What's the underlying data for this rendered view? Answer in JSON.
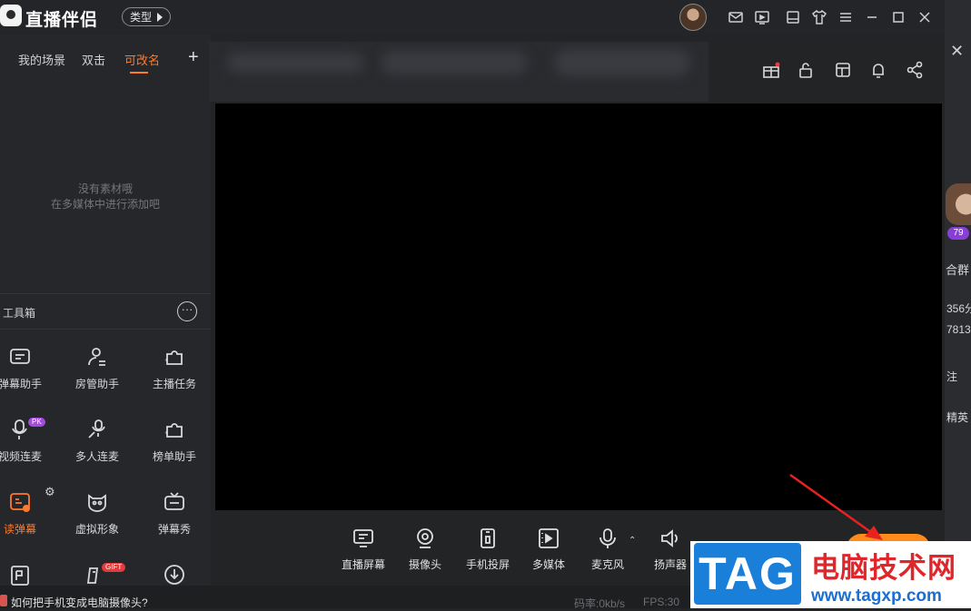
{
  "app": {
    "name": "直播伴侣",
    "type_button": "类型"
  },
  "scenes": {
    "tabs": [
      {
        "label": "我的场景",
        "active": false
      },
      {
        "label": "双击",
        "active": false
      },
      {
        "label": "可改名",
        "active": true
      }
    ],
    "add_icon": "plus-icon",
    "empty_line1": "没有素材哦",
    "empty_line2": "在多媒体中进行添加吧"
  },
  "toolbox": {
    "title": "工具箱",
    "tools": [
      {
        "label": "弹幕助手",
        "icon": "danmaku-helper-icon"
      },
      {
        "label": "房管助手",
        "icon": "room-admin-icon"
      },
      {
        "label": "主播任务",
        "icon": "puzzle-icon"
      },
      {
        "label": "视频连麦",
        "icon": "video-link-mic-icon",
        "badge": "PK"
      },
      {
        "label": "多人连麦",
        "icon": "multi-link-mic-icon"
      },
      {
        "label": "榜单助手",
        "icon": "puzzle-icon"
      },
      {
        "label": "读弹幕",
        "icon": "read-danmaku-icon",
        "active": true
      },
      {
        "label": "虚拟形象",
        "icon": "virtual-avatar-icon"
      },
      {
        "label": "弹幕秀",
        "icon": "tv-icon"
      },
      {
        "label": "",
        "icon": "text-icon"
      },
      {
        "label": "",
        "icon": "pk-icon",
        "badge": "GIFT"
      },
      {
        "label": "",
        "icon": "download-icon"
      }
    ]
  },
  "controls": [
    {
      "label": "直播屏幕",
      "icon": "screen-icon"
    },
    {
      "label": "摄像头",
      "icon": "camera-icon"
    },
    {
      "label": "手机投屏",
      "icon": "phone-cast-icon"
    },
    {
      "label": "多媒体",
      "icon": "media-icon"
    },
    {
      "label": "麦克风",
      "icon": "mic-icon"
    },
    {
      "label": "扬声器",
      "icon": "speaker-icon"
    }
  ],
  "status": {
    "tip": "如何把手机变成电脑摄像头?",
    "bitrate": "码率:0kb/s",
    "fps": "FPS:30"
  },
  "right_strip": {
    "level": "79",
    "text1": "合群",
    "text2": "356分",
    "text3": "7813",
    "text4": "注",
    "text5": "精英 ›"
  },
  "watermark": {
    "tag": "TAG",
    "site_name": "电脑技术网",
    "url": "www.tagxp.com"
  },
  "colors": {
    "accent": "#ff7a2b",
    "live_button": "#ff8c1a",
    "annotation_arrow": "#e8231f"
  }
}
